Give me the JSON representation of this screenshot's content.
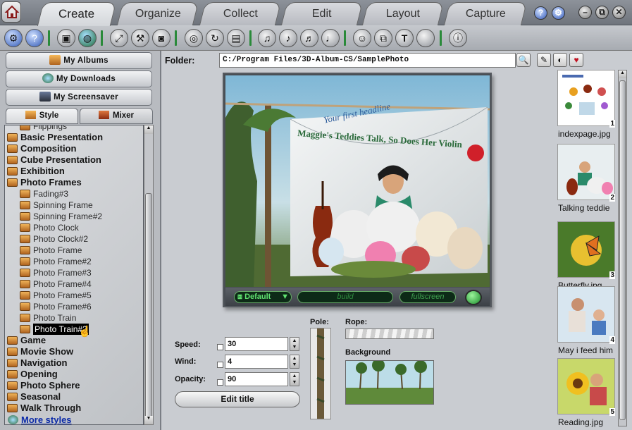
{
  "tabs": [
    {
      "label": "Create",
      "active": true
    },
    {
      "label": "Organize",
      "active": false
    },
    {
      "label": "Collect",
      "active": false
    },
    {
      "label": "Edit",
      "active": false
    },
    {
      "label": "Layout",
      "active": false
    },
    {
      "label": "Capture",
      "active": false
    }
  ],
  "window_controls": {
    "help": "?",
    "minimize": "–",
    "restore": "⧉",
    "close": "✕"
  },
  "left_buttons": {
    "albums": "My Albums",
    "downloads": "My Downloads",
    "screensaver": "My Screensaver"
  },
  "left_tabs": {
    "style": "Style",
    "mixer": "Mixer"
  },
  "tree": [
    {
      "label": "Flippings",
      "level": 1
    },
    {
      "label": "Basic Presentation",
      "level": 0
    },
    {
      "label": "Composition",
      "level": 0
    },
    {
      "label": "Cube Presentation",
      "level": 0
    },
    {
      "label": "Exhibition",
      "level": 0
    },
    {
      "label": "Photo Frames",
      "level": 0,
      "open": true
    },
    {
      "label": "Fading#3",
      "level": 1
    },
    {
      "label": "Spinning Frame",
      "level": 1
    },
    {
      "label": "Spinning Frame#2",
      "level": 1
    },
    {
      "label": "Photo Clock",
      "level": 1
    },
    {
      "label": "Photo Clock#2",
      "level": 1
    },
    {
      "label": "Photo Frame",
      "level": 1
    },
    {
      "label": "Photo Frame#2",
      "level": 1
    },
    {
      "label": "Photo Frame#3",
      "level": 1
    },
    {
      "label": "Photo Frame#4",
      "level": 1
    },
    {
      "label": "Photo Frame#5",
      "level": 1
    },
    {
      "label": "Photo Frame#6",
      "level": 1
    },
    {
      "label": "Photo Train",
      "level": 1
    },
    {
      "label": "Photo Train#2",
      "level": 1,
      "selected": true
    },
    {
      "label": "Game",
      "level": 0
    },
    {
      "label": "Movie Show",
      "level": 0
    },
    {
      "label": "Navigation",
      "level": 0
    },
    {
      "label": "Opening",
      "level": 0
    },
    {
      "label": "Photo Sphere",
      "level": 0
    },
    {
      "label": "Seasonal",
      "level": 0
    },
    {
      "label": "Walk Through",
      "level": 0
    }
  ],
  "more_styles": "More styles",
  "folder": {
    "label": "Folder:",
    "path": "C:/Program  Files/3D-Album-CS/SamplePhoto"
  },
  "preview": {
    "headline": "Your first headline",
    "banner": "Maggie's Teddies Talk, So Does Her Violin",
    "default_btn": "Default",
    "build_label": "build",
    "fullscreen_label": "fullscreen"
  },
  "settings": {
    "speed_label": "Speed:",
    "speed": "30",
    "wind_label": "Wind:",
    "wind": "4",
    "opacity_label": "Opacity:",
    "opacity": "90",
    "pole_label": "Pole:",
    "rope_label": "Rope:",
    "background_label": "Background",
    "edit_title": "Edit title"
  },
  "thumbnails": [
    {
      "num": "1",
      "caption": "indexpage.jpg"
    },
    {
      "num": "2",
      "caption": "Talking teddie"
    },
    {
      "num": "3",
      "caption": "Butterfly.jpg"
    },
    {
      "num": "4",
      "caption": "May i feed him"
    },
    {
      "num": "5",
      "caption": "Reading.jpg"
    }
  ],
  "colors": {
    "accent_green": "#2a8a3a",
    "selection": "#000000",
    "link_blue": "#0b2aa8"
  }
}
